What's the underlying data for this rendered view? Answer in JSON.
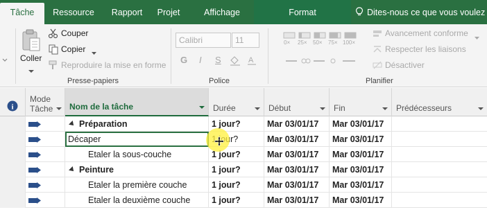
{
  "tabs": [
    {
      "label": "Tâche",
      "active": true
    },
    {
      "label": "Ressource",
      "active": false
    },
    {
      "label": "Rapport",
      "active": false
    },
    {
      "label": "Projet",
      "active": false
    },
    {
      "label": "Affichage",
      "active": false
    }
  ],
  "context_tab": "Format",
  "tell_me": "Dites-nous ce que vous voulez",
  "ribbon": {
    "clipboard": {
      "paste": "Coller",
      "cut": "Couper",
      "copy": "Copier",
      "format_painter": "Reproduire la mise en forme",
      "group_label": "Presse-papiers"
    },
    "font": {
      "font_name": "Calibri",
      "font_size": "11",
      "bold": "G",
      "italic": "I",
      "underline": "S",
      "group_label": "Police"
    },
    "schedule": {
      "progress_labels": [
        "0×",
        "25×",
        "50×",
        "75×",
        "100×"
      ],
      "mark_on_track": "Avancement conforme",
      "respect_links": "Respecter les liaisons",
      "deactivate": "Désactiver",
      "group_label": "Planifier"
    }
  },
  "grid": {
    "headers": {
      "info": "i",
      "mode_line1": "Mode",
      "mode_line2": "Tâche",
      "name": "Nom de la tâche",
      "duration": "Durée",
      "start": "Début",
      "finish": "Fin",
      "predecessors": "Prédécesseurs"
    },
    "rows": [
      {
        "name": "Préparation",
        "duration": "1 jour?",
        "start": "Mar 03/01/17",
        "finish": "Mar 03/01/17",
        "summary": true,
        "indent": 1
      },
      {
        "name": "Décaper",
        "duration": "1 jour?",
        "start": "Mar 03/01/17",
        "finish": "Mar 03/01/17",
        "summary": false,
        "indent": 0
      },
      {
        "name": "Etaler la sous-couche",
        "duration": "1 jour?",
        "start": "Mar 03/01/17",
        "finish": "Mar 03/01/17",
        "summary": false,
        "indent": 2
      },
      {
        "name": "Peinture",
        "duration": "1 jour?",
        "start": "Mar 03/01/17",
        "finish": "Mar 03/01/17",
        "summary": true,
        "indent": 1
      },
      {
        "name": "Etaler la première couche",
        "duration": "1 jour?",
        "start": "Mar 03/01/17",
        "finish": "Mar 03/01/17",
        "summary": false,
        "indent": 2
      },
      {
        "name": "Etaler la deuxième couche",
        "duration": "1 jour?",
        "start": "Mar 03/01/17",
        "finish": "Mar 03/01/17",
        "summary": false,
        "indent": 2
      }
    ]
  },
  "colors": {
    "ribbon_green": "#2a7041",
    "context_green": "#217346",
    "mode_icon_blue": "#2b4f8a"
  }
}
